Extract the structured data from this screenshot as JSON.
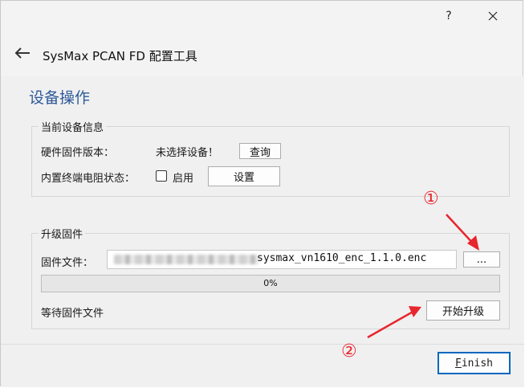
{
  "window": {
    "help_label": "?",
    "close_label": "✕"
  },
  "header": {
    "title": "SysMax PCAN FD 配置工具",
    "back_icon": "back-arrow-icon"
  },
  "page": {
    "heading": "设备操作"
  },
  "device_info": {
    "group_title": "当前设备信息",
    "firmware_label": "硬件固件版本：",
    "firmware_value": "未选择设备！",
    "query_button": "查询",
    "termination_label": "内置终端电阻状态：",
    "enable_checkbox_label": "启用",
    "enable_checked": false,
    "settings_button": "设置"
  },
  "upgrade": {
    "group_title": "升级固件",
    "file_label": "固件文件：",
    "file_value": "sysmax_vn1610_enc_1.1.0.enc",
    "browse_button": "...",
    "progress": 0,
    "progress_text": "0%",
    "status_text": "等待固件文件",
    "start_button": "开始升级"
  },
  "footer": {
    "finish_mnemonic": "F",
    "finish_rest": "inish"
  },
  "annotations": {
    "marker_1": "①",
    "marker_2": "②",
    "color": "#e8262e"
  },
  "colors": {
    "heading": "#2e5a9a",
    "accent": "#0067c0"
  }
}
